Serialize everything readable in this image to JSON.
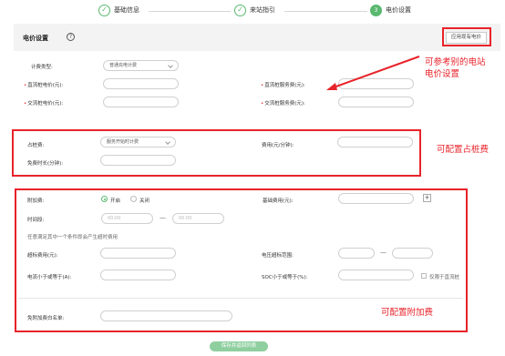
{
  "steps": [
    {
      "label": "基础信息",
      "icon": "✓"
    },
    {
      "label": "来站指引",
      "icon": "✓"
    },
    {
      "label": "电价设置",
      "icon": "3"
    }
  ],
  "header": {
    "title": "电价设置",
    "help_icon": "?",
    "apply_button": "应用现有电价"
  },
  "pricing": {
    "billing_type_label": "计费类型:",
    "billing_type_value": "普通充电计费",
    "dc_price_label": "直流桩电价(元):",
    "dc_service_label": "直流桩服务费(元):",
    "ac_price_label": "交流桩电价(元):",
    "ac_service_label": "交流桩服务费(元):"
  },
  "occupy": {
    "fee_label": "占桩费:",
    "fee_select": "服务开始时计费",
    "rate_label": "费用(元/分钟):",
    "free_label": "免费时长(分钟):"
  },
  "surcharge": {
    "label": "附加费:",
    "on_label": "开启",
    "off_label": "关闭",
    "base_label": "基础费用(元):",
    "plus": "+",
    "period_label": "时间段:",
    "time_start": "00:00",
    "time_end": "00:00",
    "dash": "—",
    "condition_note": "任意满足其中一个条件即会产生超时费用",
    "over_fee_label": "超标费用(元):",
    "voltage_label": "电压超标范围:",
    "current_label": "电流小于或等于(A):",
    "soc_label": "SOC小于或等于(%):",
    "dc_only_label": "仅限于直流桩",
    "whitelist_label": "免附加费白名单:"
  },
  "annotations": {
    "reference": "可参考别的电站\n电价设置",
    "occupy": "可配置占桩费",
    "surcharge": "可配置附加费"
  },
  "footer": {
    "save_button": "保存并返回列表"
  },
  "colors": {
    "accent_green": "#59b86f",
    "annotation_red": "#e8232a"
  }
}
